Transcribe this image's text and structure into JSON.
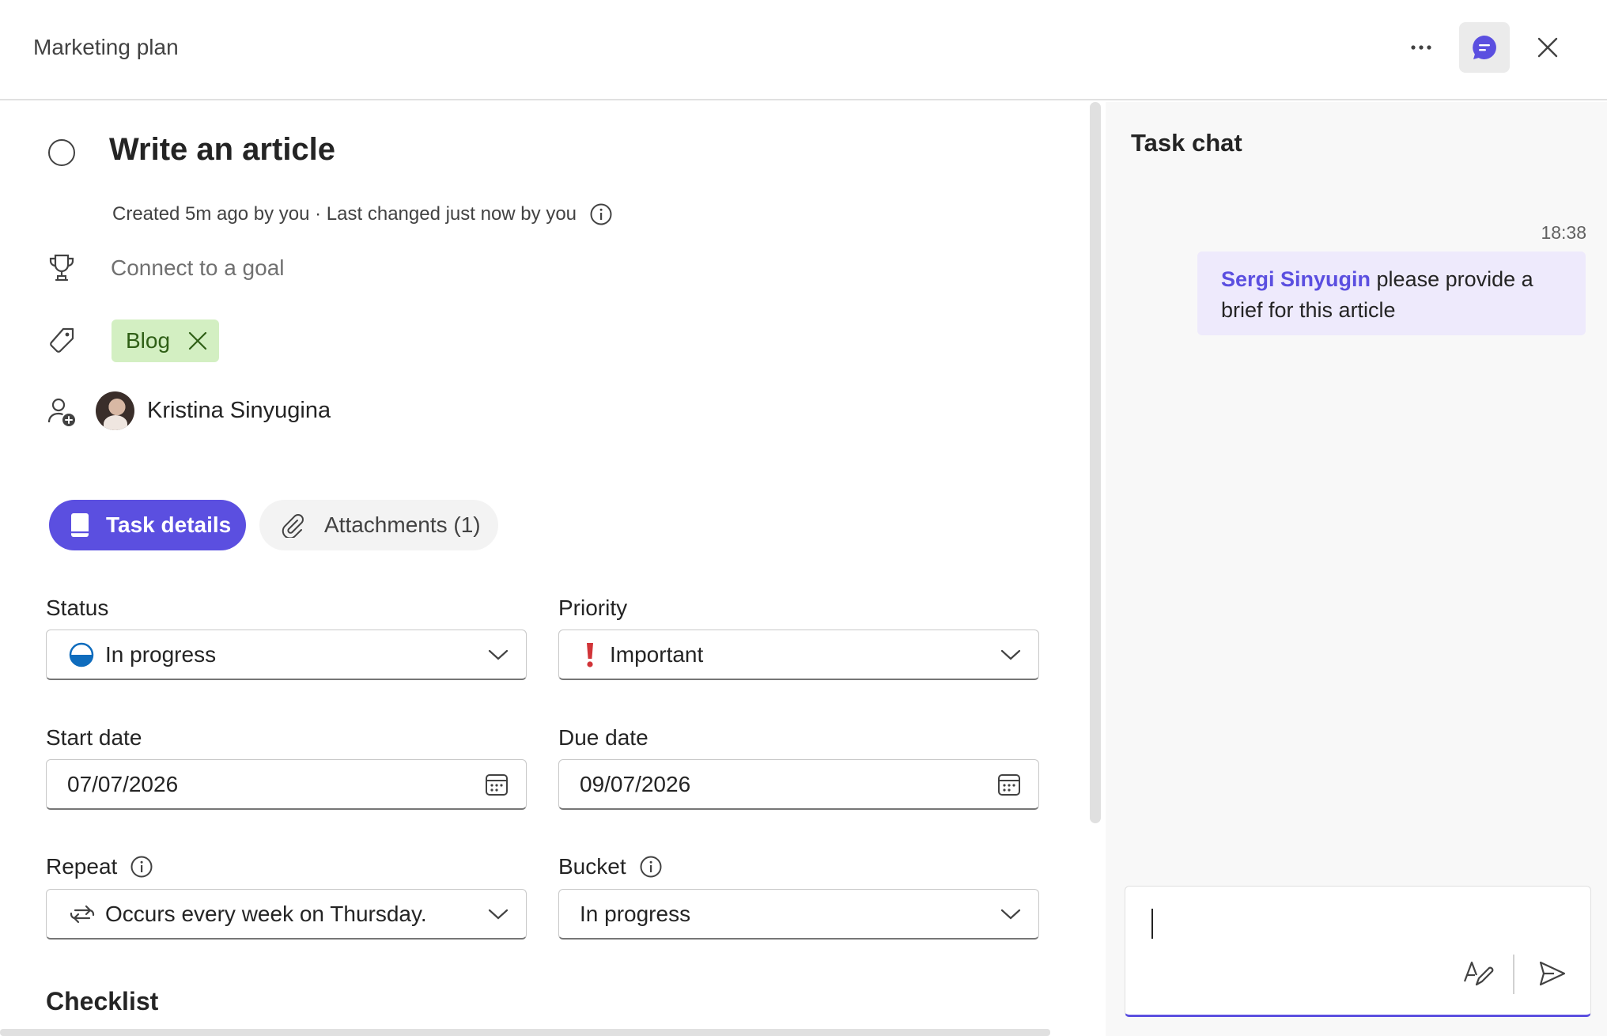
{
  "header": {
    "title": "Marketing plan",
    "more_icon": "more-horizontal-icon",
    "chat_icon": "chat-icon",
    "close_icon": "close-icon",
    "accent": "#5b4fe0"
  },
  "task": {
    "title": "Write an article",
    "meta": "Created 5m ago by you · Last changed just now by you",
    "goal_placeholder": "Connect to a goal",
    "label": "Blog",
    "label_color": "#d3efc2",
    "assignee": "Kristina Sinyugina"
  },
  "tabs": {
    "details": "Task details",
    "attachments": "Attachments (1)"
  },
  "fields": {
    "status_label": "Status",
    "status_value": "In progress",
    "priority_label": "Priority",
    "priority_value": "Important",
    "start_label": "Start date",
    "start_value": "07/07/2026",
    "due_label": "Due date",
    "due_value": "09/07/2026",
    "repeat_label": "Repeat",
    "repeat_value": "Occurs every week on Thursday.",
    "bucket_label": "Bucket",
    "bucket_value": "In progress"
  },
  "checklist": {
    "title": "Checklist"
  },
  "chat": {
    "title": "Task chat",
    "message_time": "18:38",
    "message_mention": "Sergi Sinyugin",
    "message_text": " please provide a brief for this article"
  }
}
